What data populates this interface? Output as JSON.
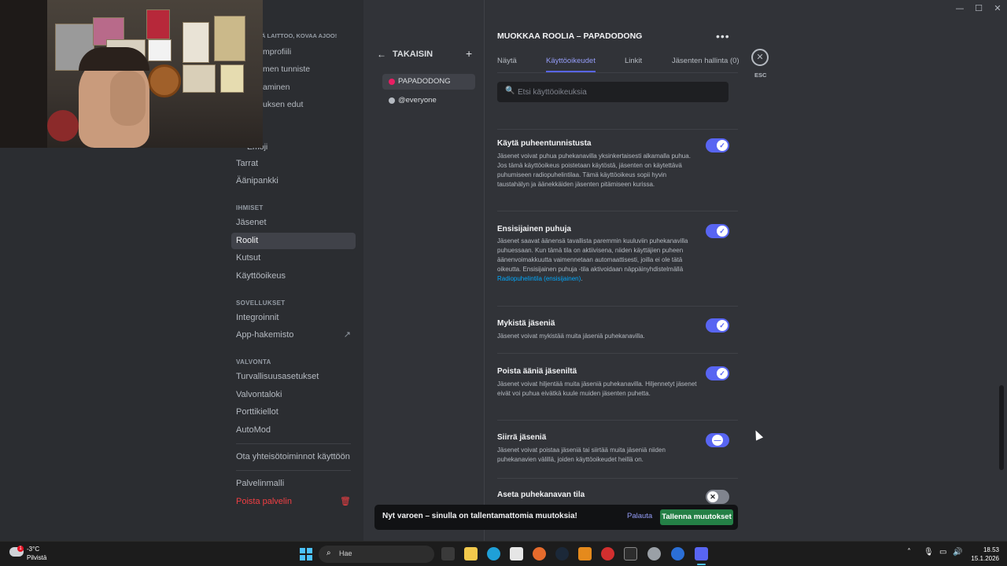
{
  "window_controls": {
    "minimize": "—",
    "maximize": "☐",
    "close": "✕"
  },
  "nav": {
    "top_items": [
      "Ä LAITTOO, KOVAA AJOO!",
      "mprofiili",
      "men tunniste",
      "aminen",
      "uksen edut",
      "Emoji"
    ],
    "items_a": [
      "Tarrat",
      "Äänipankki"
    ],
    "section_people": "IHMISET",
    "people": [
      "Jäsenet",
      "Roolit",
      "Kutsut",
      "Käyttöoikeus"
    ],
    "section_apps": "SOVELLUKSET",
    "apps": [
      "Integroinnit",
      "App-hakemisto"
    ],
    "app_dir_icon": "external-link-icon",
    "section_mod": "VALVONTA",
    "mod": [
      "Turvallisuusasetukset",
      "Valvontaloki",
      "Porttikiellot",
      "AutoMod"
    ],
    "community": "Ota yhteisötoiminnot käyttöön",
    "template": "Palvelinmalli",
    "delete": "Poista palvelin",
    "delete_icon": "trash-icon"
  },
  "roles_panel": {
    "back_label": "TAKAISIN",
    "back_icon": "arrow-left-icon",
    "add_icon": "plus-icon",
    "roles": [
      {
        "name": "PAPADODONG",
        "color": "#e91e63"
      },
      {
        "name": "@everyone",
        "color": "#b5bac1"
      }
    ]
  },
  "editor": {
    "title": "MUOKKAA ROOLIA – PAPADODONG",
    "more_icon": "more-horizontal-icon",
    "tabs": [
      "Näytä",
      "Käyttöoikeudet",
      "Linkit",
      "Jäsenten hallinta (0)"
    ],
    "active_tab": "Käyttöoikeudet",
    "search_placeholder": "Etsi käyttöoikeuksia",
    "search_icon": "search-icon",
    "close_icon": "close-icon",
    "esc_label": "ESC",
    "permissions": [
      {
        "title": "Käytä puheentunnistusta",
        "desc": "Jäsenet voivat puhua puhekanavilla yksinkertaisesti alkamalla puhua. Jos tämä käyttöoikeus poistetaan käytöstä, jäsenten on käytettävä puhumiseen radiopuhelintilaa. Tämä käyttöoikeus sopii hyvin taustahälyn ja äänekkäiden jäsenten pitämiseen kurissa.",
        "enabled": true
      },
      {
        "title": "Ensisijainen puhuja",
        "desc": "Jäsenet saavat äänensä tavallista paremmin kuuluviin puhekanavilla puhuessaan. Kun tämä tila on aktiivisena, niiden käyttäjien puheen äänenvoimakkuutta vaimennetaan automaattisesti, joilla ei ole tätä oikeutta. Ensisijainen puhuja -tila aktivoidaan näppäinyhdistelmällä",
        "link": "Radiopuhelintila (ensisijainen)",
        "desc_end": ".",
        "enabled": true
      },
      {
        "title": "Mykistä jäseniä",
        "desc": "Jäsenet voivat mykistää muita jäseniä puhekanavilla.",
        "enabled": true
      },
      {
        "title": "Poista ääniä jäseniltä",
        "desc": "Jäsenet voivat hiljentää muita jäseniä puhekanavilla. Hiljennetyt jäsenet eivät voi puhua eivätkä kuule muiden jäsenten puhetta.",
        "enabled": true
      },
      {
        "title": "Siirrä jäseniä",
        "desc": "Jäsenet voivat poistaa jäseniä tai siirtää muita jäseniä niiden puhekanavien välillä, joiden käyttöoikeudet heillä on.",
        "enabled": true
      },
      {
        "title": "Aseta puhekanavan tila",
        "enabled": false
      }
    ],
    "toggle_on_glyph": "✓",
    "toggle_mid_glyph": "—",
    "toggle_off_glyph": "✕"
  },
  "unsaved": {
    "message": "Nyt varoen – sinulla on tallentamattomia muutoksia!",
    "reset": "Palauta",
    "save": "Tallenna muutokset"
  },
  "taskbar": {
    "temperature": "-3°C",
    "condition": "Pilvistä",
    "weather_badge": "1",
    "search_placeholder": "Hae",
    "search_icon": "search-icon",
    "apps": [
      "task-view-icon",
      "file-explorer-icon",
      "edge-icon",
      "store-icon",
      "firefox-icon",
      "steam-icon",
      "vlc-icon",
      "opera-icon",
      "terminal-icon",
      "settings-icon",
      "app-icon",
      "discord-icon"
    ],
    "tray": [
      "chevron-up-icon",
      "mic-icon",
      "display-icon",
      "volume-icon"
    ],
    "time": "18.53",
    "date": "15.1.2026"
  }
}
